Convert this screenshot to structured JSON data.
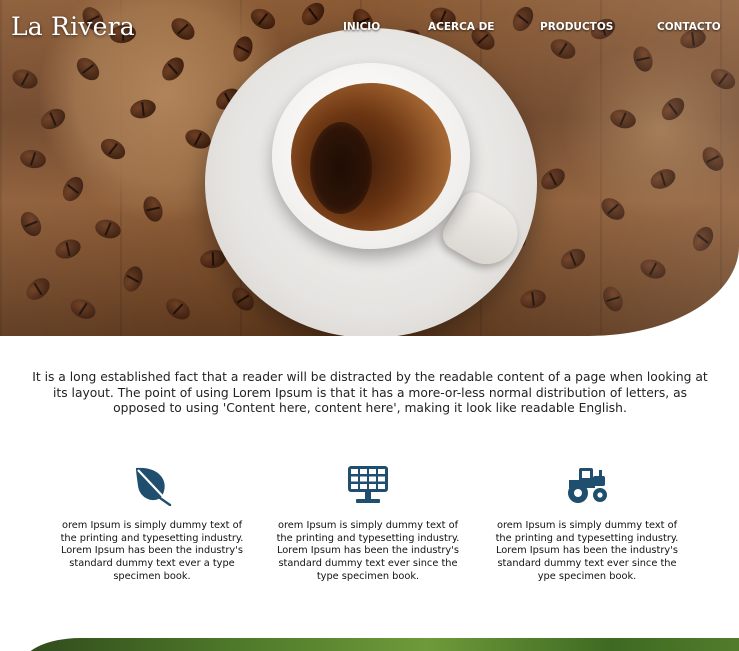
{
  "brand": {
    "logo_text": "La Rivera"
  },
  "nav": {
    "items": [
      {
        "label": "INICIO"
      },
      {
        "label": "ACERCA DE"
      },
      {
        "label": "PRODUCTOS"
      },
      {
        "label": "CONTACTO"
      }
    ]
  },
  "hero": {
    "image": "coffee-cup-with-beans"
  },
  "intro": {
    "text": "It is a long established fact that a reader will be distracted by the readable content of a page when looking at its layout. The point of using Lorem Ipsum is that it has a more-or-less normal distribution of letters, as opposed to using 'Content here, content here', making it look like readable English."
  },
  "features": [
    {
      "icon": "leaf-icon",
      "text": "orem Ipsum is simply dummy text of the printing and typesetting industry. Lorem Ipsum has been the industry's standard dummy text ever a type specimen book."
    },
    {
      "icon": "solar-panel-icon",
      "text": "orem Ipsum is simply dummy text of the printing and typesetting industry. Lorem Ipsum has been the industry's standard dummy text ever since the type specimen book."
    },
    {
      "icon": "tractor-icon",
      "text": "orem Ipsum is simply dummy text of the printing and typesetting industry. Lorem Ipsum has been the industry's standard dummy text ever since the ype specimen book."
    }
  ],
  "colors": {
    "icon": "#1f4e6e",
    "text": "#222222",
    "nav_text": "#ffffff"
  }
}
